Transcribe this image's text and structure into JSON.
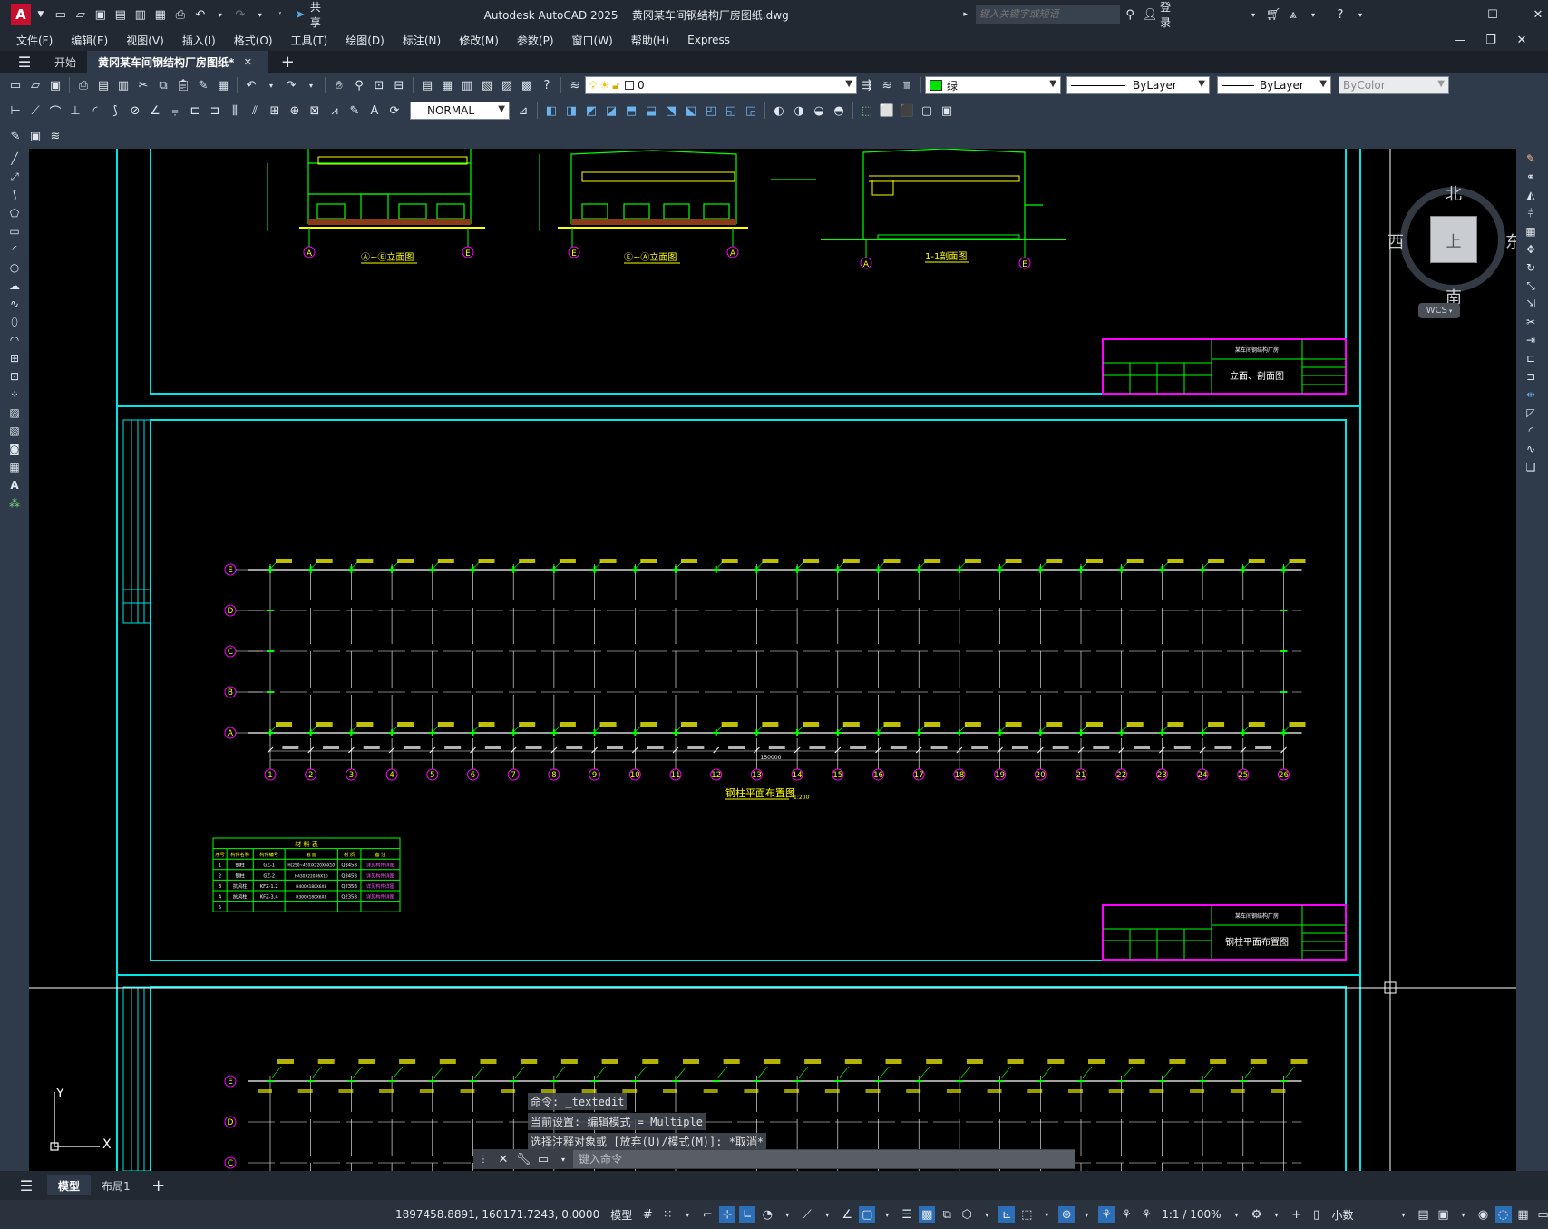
{
  "app": {
    "logo": "A",
    "share_label": "共享",
    "title": "Autodesk AutoCAD 2025    黄冈某车间钢结构厂房图纸.dwg",
    "search_placeholder": "键入关键字或短语",
    "login_label": "登录"
  },
  "menu": [
    "文件(F)",
    "编辑(E)",
    "视图(V)",
    "插入(I)",
    "格式(O)",
    "工具(T)",
    "绘图(D)",
    "标注(N)",
    "修改(M)",
    "参数(P)",
    "窗口(W)",
    "帮助(H)",
    "Express"
  ],
  "tabs": {
    "start": "开始",
    "file": "黄冈某车间钢结构厂房图纸*"
  },
  "toolbar": {
    "layer": "0",
    "color": "绿",
    "color_hex": "#00e400",
    "linetype": "ByLayer",
    "lineweight": "ByLayer",
    "plotstyle": "ByColor",
    "textstyle": "NORMAL"
  },
  "viewcube": {
    "north": "北",
    "south": "南",
    "east": "东",
    "west": "西",
    "top": "上",
    "wcs": "WCS"
  },
  "drawing": {
    "elev1_title": "Ⓐ~Ⓔ立面图",
    "elev2_title": "Ⓔ~Ⓐ立面图",
    "section_title": "1-1剖面图",
    "scale": "1:200",
    "titleblock1": {
      "project": "某车间钢结构厂房",
      "sheet": "立面、剖面图"
    },
    "titleblock2": {
      "project": "某车间钢结构厂房",
      "sheet": "钢柱平面布置图"
    },
    "plan_title": "钢柱平面布置图",
    "total_dim": "150000",
    "bay_dim": "6000",
    "col_labels": [
      "1",
      "2",
      "3",
      "4",
      "5",
      "6",
      "7",
      "8",
      "9",
      "10",
      "11",
      "12",
      "13",
      "14",
      "15",
      "16",
      "17",
      "18",
      "19",
      "20",
      "21",
      "22",
      "23",
      "24",
      "25",
      "26"
    ],
    "row_labels": [
      "E",
      "D",
      "C",
      "B",
      "A"
    ],
    "material_table": {
      "title": "材 料 表",
      "headers": [
        "序号",
        "构件名称",
        "构件编号",
        "截 面",
        "材 质",
        "备 注"
      ],
      "rows": [
        [
          "1",
          "钢柱",
          "GZ-1",
          "H(250~450)X220X6X10",
          "Q345B",
          "详见构件详图"
        ],
        [
          "2",
          "钢柱",
          "GZ-2",
          "H430X220X6X10",
          "Q345B",
          "详见构件详图"
        ],
        [
          "3",
          "抗风柱",
          "KFZ-1.2",
          "H400X180X6X8",
          "Q235B",
          "详见构件详图"
        ],
        [
          "4",
          "抗风柱",
          "KFZ-3.4",
          "H300X180X6X8",
          "Q235B",
          "详见构件详图"
        ],
        [
          "5",
          "",
          "",
          "",
          "",
          ""
        ]
      ]
    }
  },
  "command": {
    "history": [
      "命令:  _textedit",
      "当前设置: 编辑模式 = Multiple",
      "选择注释对象或 [放弃(U)/模式(M)]: *取消*"
    ],
    "placeholder": "键入命令"
  },
  "layout_tabs": [
    "模型",
    "布局1"
  ],
  "status": {
    "coords": "1897458.8891, 160171.7243, 0.0000",
    "model": "模型",
    "scale": "1:1 / 100%",
    "units": "小数"
  }
}
